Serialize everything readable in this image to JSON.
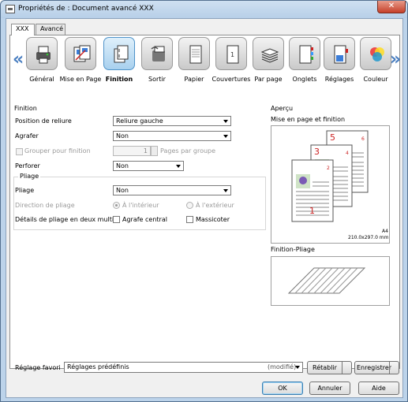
{
  "window": {
    "title": "Propriétés de : Document avancé XXX",
    "close_glyph": "✕"
  },
  "tabs": [
    {
      "label": "XXX"
    },
    {
      "label": "Avancé"
    }
  ],
  "toolbar": {
    "left_arrow": "«",
    "right_arrow": "»",
    "items": [
      {
        "label": "Général",
        "icon": "printer-icon"
      },
      {
        "label": "Mise en Page",
        "icon": "layout-icon"
      },
      {
        "label": "Finition",
        "icon": "finishing-icon",
        "selected": true
      },
      {
        "label": "Sortir",
        "icon": "output-tray-icon"
      },
      {
        "label": "Papier",
        "icon": "paper-icon"
      },
      {
        "label": "Couvertures",
        "icon": "cover-icon"
      },
      {
        "label": "Par page",
        "icon": "paper-stack-icon"
      },
      {
        "label": "Onglets",
        "icon": "tab-sheets-icon"
      },
      {
        "label": "Réglages",
        "icon": "settings-sheets-icon"
      },
      {
        "label": "Couleur",
        "icon": "color-icon"
      }
    ]
  },
  "finition": {
    "section_title": "Finition",
    "binding_label": "Position de reliure",
    "binding_value": "Reliure gauche",
    "staple_label": "Agrafer",
    "staple_value": "Non",
    "group_label": "Grouper pour finition",
    "group_count": "1",
    "pages_per_group_label": "Pages par groupe",
    "punch_label": "Perforer",
    "punch_value": "Non",
    "fold_section_title": "Pliage",
    "fold_label": "Pliage",
    "fold_value": "Non",
    "fold_direction_label": "Direction de pliage",
    "fold_inside_label": "À l'intérieur",
    "fold_outside_label": "À l'extérieur",
    "two_fold_label": "Détails de pliage en deux multi",
    "center_staple_label": "Agrafe central",
    "trim_label": "Massicoter"
  },
  "apercu": {
    "title": "Aperçu",
    "layout_label": "Mise en page et finition",
    "page_numbers": [
      "1",
      "3",
      "5"
    ],
    "page_badges": [
      "2",
      "4",
      "6"
    ],
    "paper_size": "A4",
    "paper_dims": "210.0x297.0 mm",
    "fold_label": "Finition-Pliage"
  },
  "favorites": {
    "label": "Réglage favori",
    "value": "Réglages prédéfinis",
    "modified": "(modifié)",
    "restore_button": "Rétablir",
    "save_button": "Enregistrer"
  },
  "buttons": {
    "ok": "OK",
    "cancel": "Annuler",
    "help": "Aide"
  },
  "colors": {
    "accent": "#4a7fc1",
    "selected_tile": "#a8d0ee",
    "page_number_red": "#cc2222"
  }
}
